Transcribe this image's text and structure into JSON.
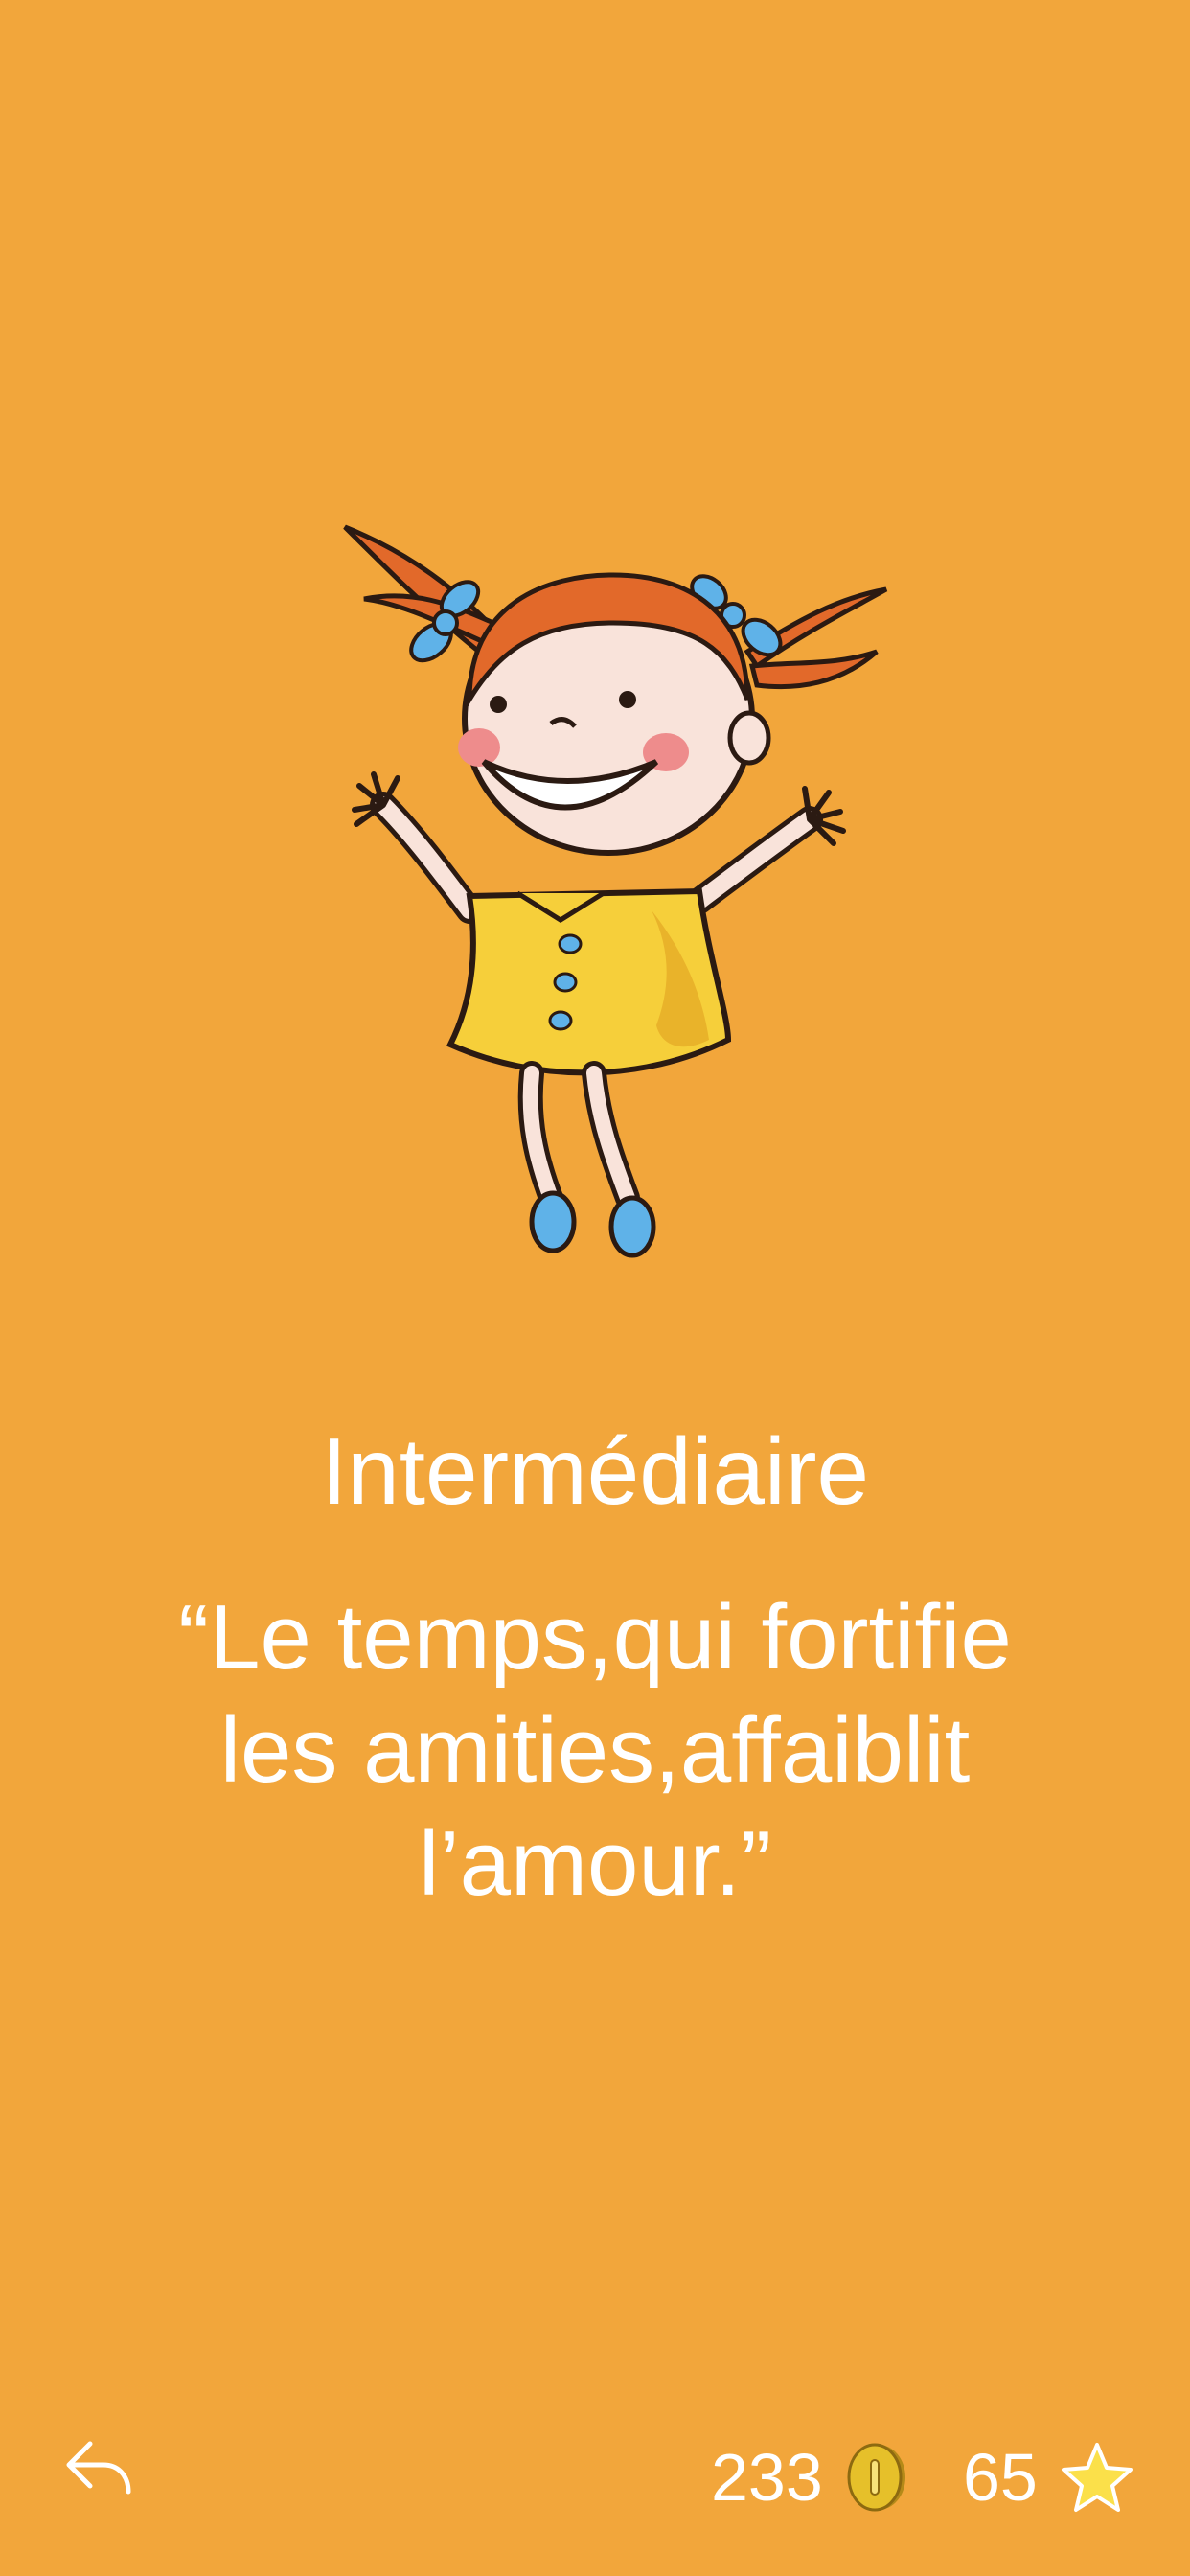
{
  "level": {
    "title": "Intermédiaire"
  },
  "quote": {
    "text": "“Le temps,qui fortifie les amities,affaiblit l’amour.”"
  },
  "footer": {
    "back_icon": "share-back-icon",
    "coins": {
      "value": "233",
      "icon": "coin-icon"
    },
    "stars": {
      "value": "65",
      "icon": "star-icon"
    }
  },
  "colors": {
    "background": "#F2A63B",
    "text": "#FFFFFF",
    "dress": "#F6CF3A",
    "hair": "#E2692A",
    "accent_blue": "#5FB2E8",
    "coin": "#E6C02A",
    "star": "#FBE04A"
  }
}
